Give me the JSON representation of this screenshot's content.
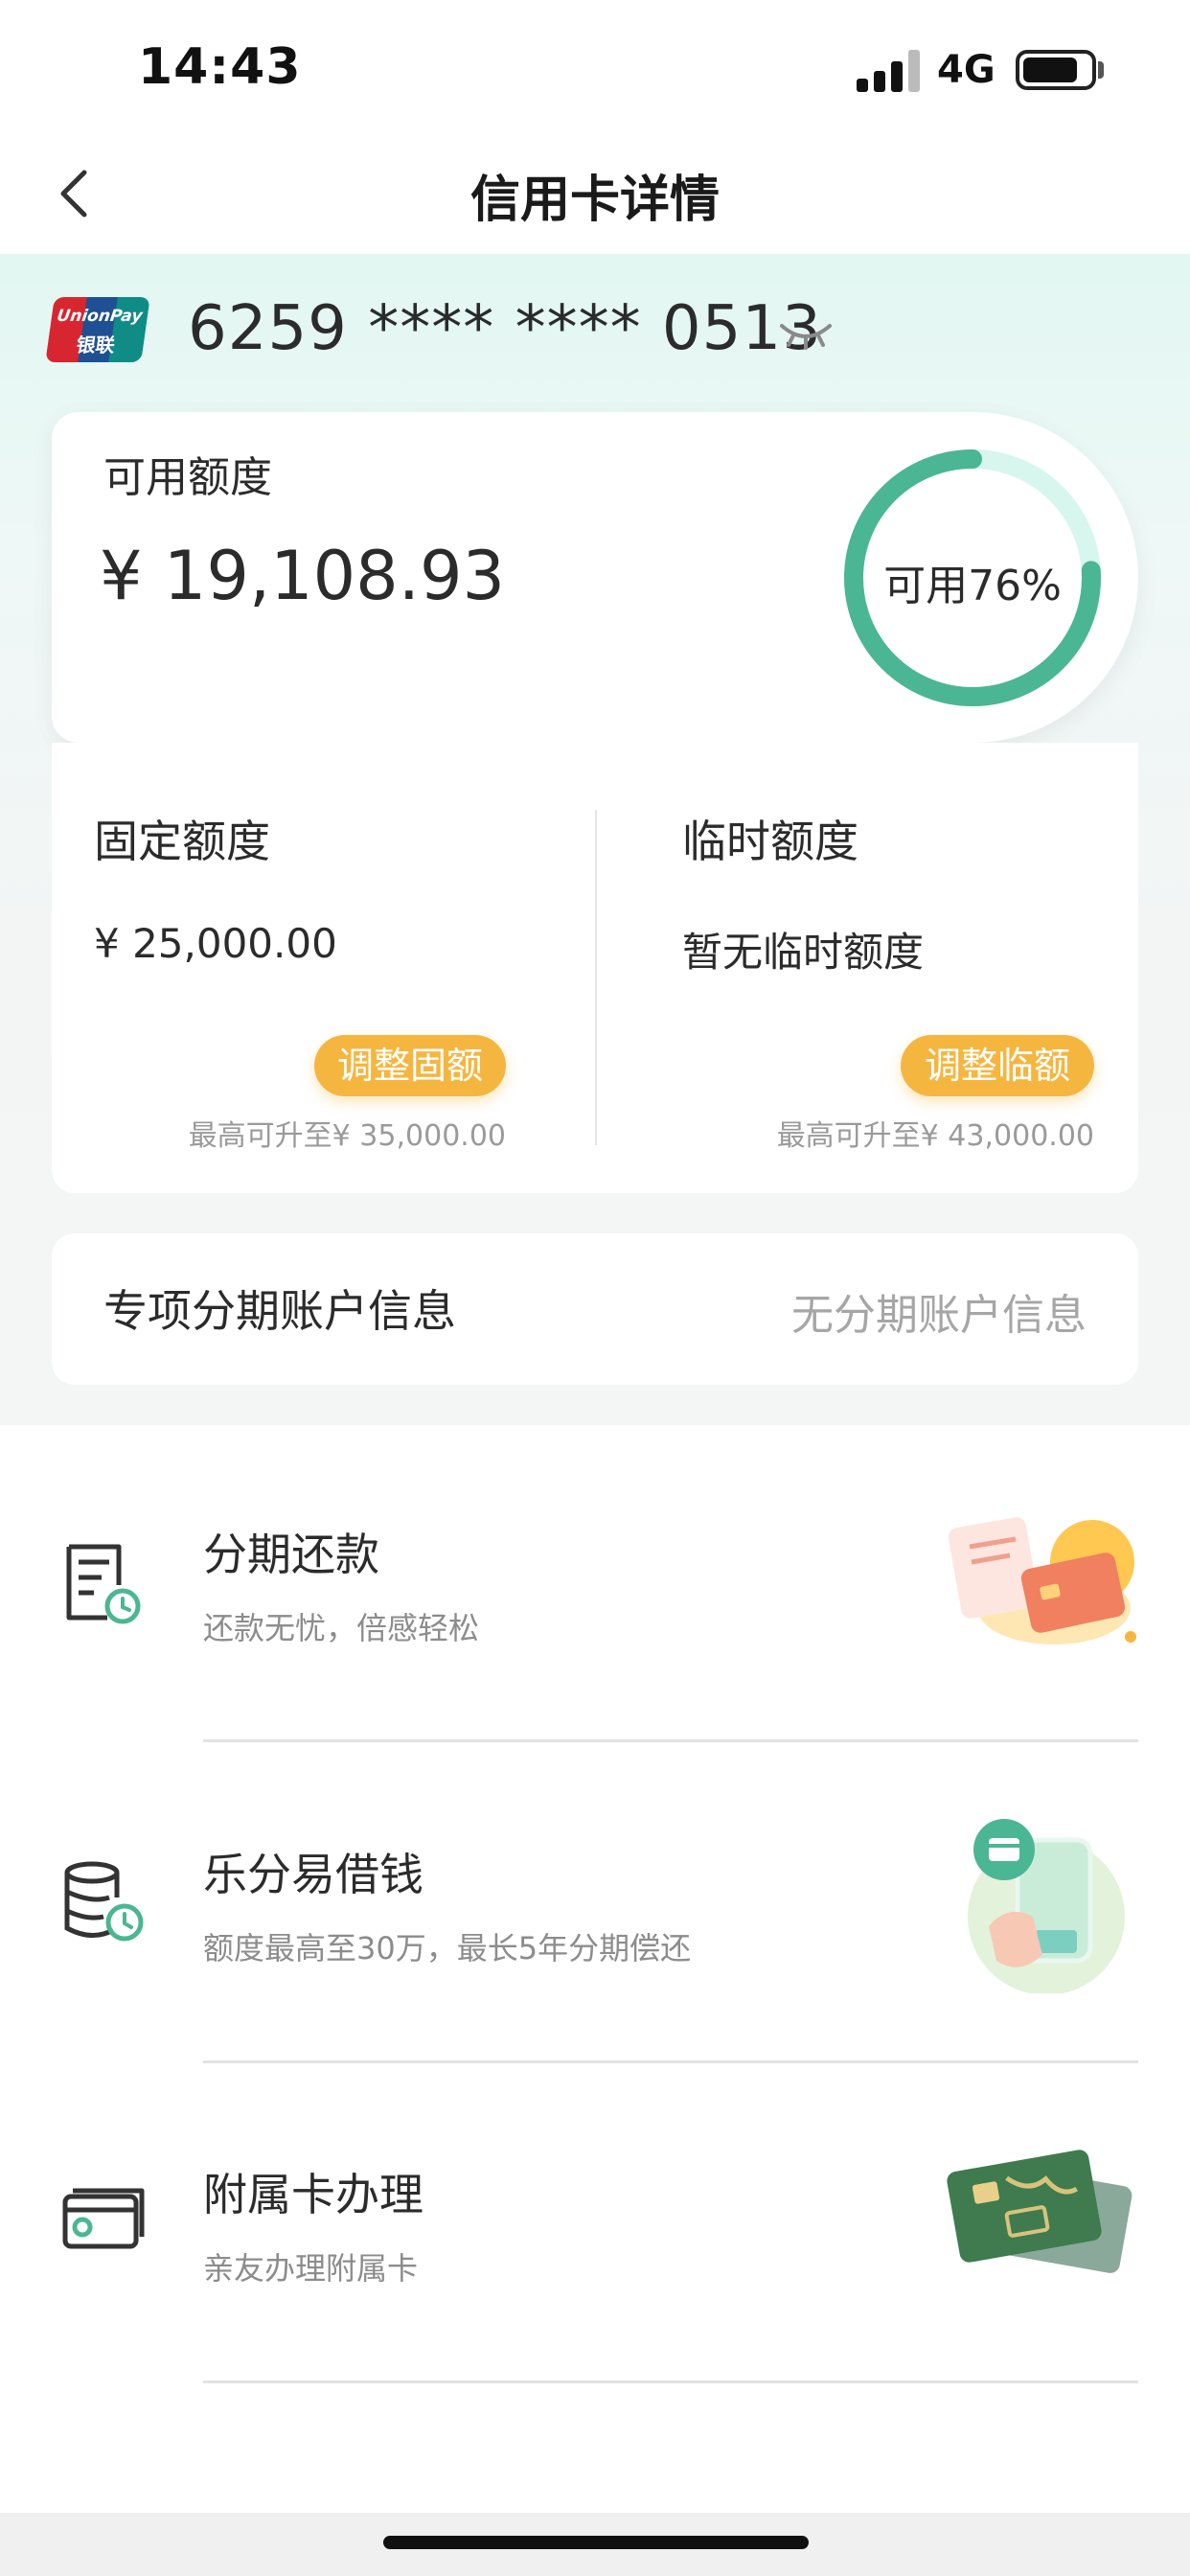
{
  "status_bar": {
    "time": "14:43",
    "network": "4G"
  },
  "nav": {
    "title": "信用卡详情"
  },
  "card": {
    "brand": "UnionPay 银联",
    "brand_line1": "UnionPay",
    "brand_line2": "银联",
    "number": "6259 **** **** 0513"
  },
  "available": {
    "label": "可用额度",
    "amount": "¥ 19,108.93",
    "percent_text": "可用76%",
    "percent": 76
  },
  "fixed": {
    "title": "固定额度",
    "value": "¥ 25,000.00",
    "button": "调整固额",
    "hint": "最高可升至¥ 35,000.00"
  },
  "temporary": {
    "title": "临时额度",
    "value": "暂无临时额度",
    "button": "调整临额",
    "hint": "最高可升至¥ 43,000.00"
  },
  "installment_account": {
    "label": "专项分期账户信息",
    "value": "无分期账户信息"
  },
  "services": [
    {
      "title": "分期还款",
      "subtitle": "还款无忧，倍感轻松",
      "icon": "bill-clock-icon",
      "illustration": "bill-card-illustration"
    },
    {
      "title": "乐分易借钱",
      "subtitle": "额度最高至30万，最长5年分期偿还",
      "icon": "coins-clock-icon",
      "illustration": "phone-payment-illustration"
    },
    {
      "title": "附属卡办理",
      "subtitle": "亲友办理附属卡",
      "icon": "card-icon",
      "illustration": "supplementary-card-illustration"
    }
  ],
  "colors": {
    "accent_green": "#4bb693",
    "ring_track": "#d6f6ee",
    "button_orange": "#f5b640"
  }
}
